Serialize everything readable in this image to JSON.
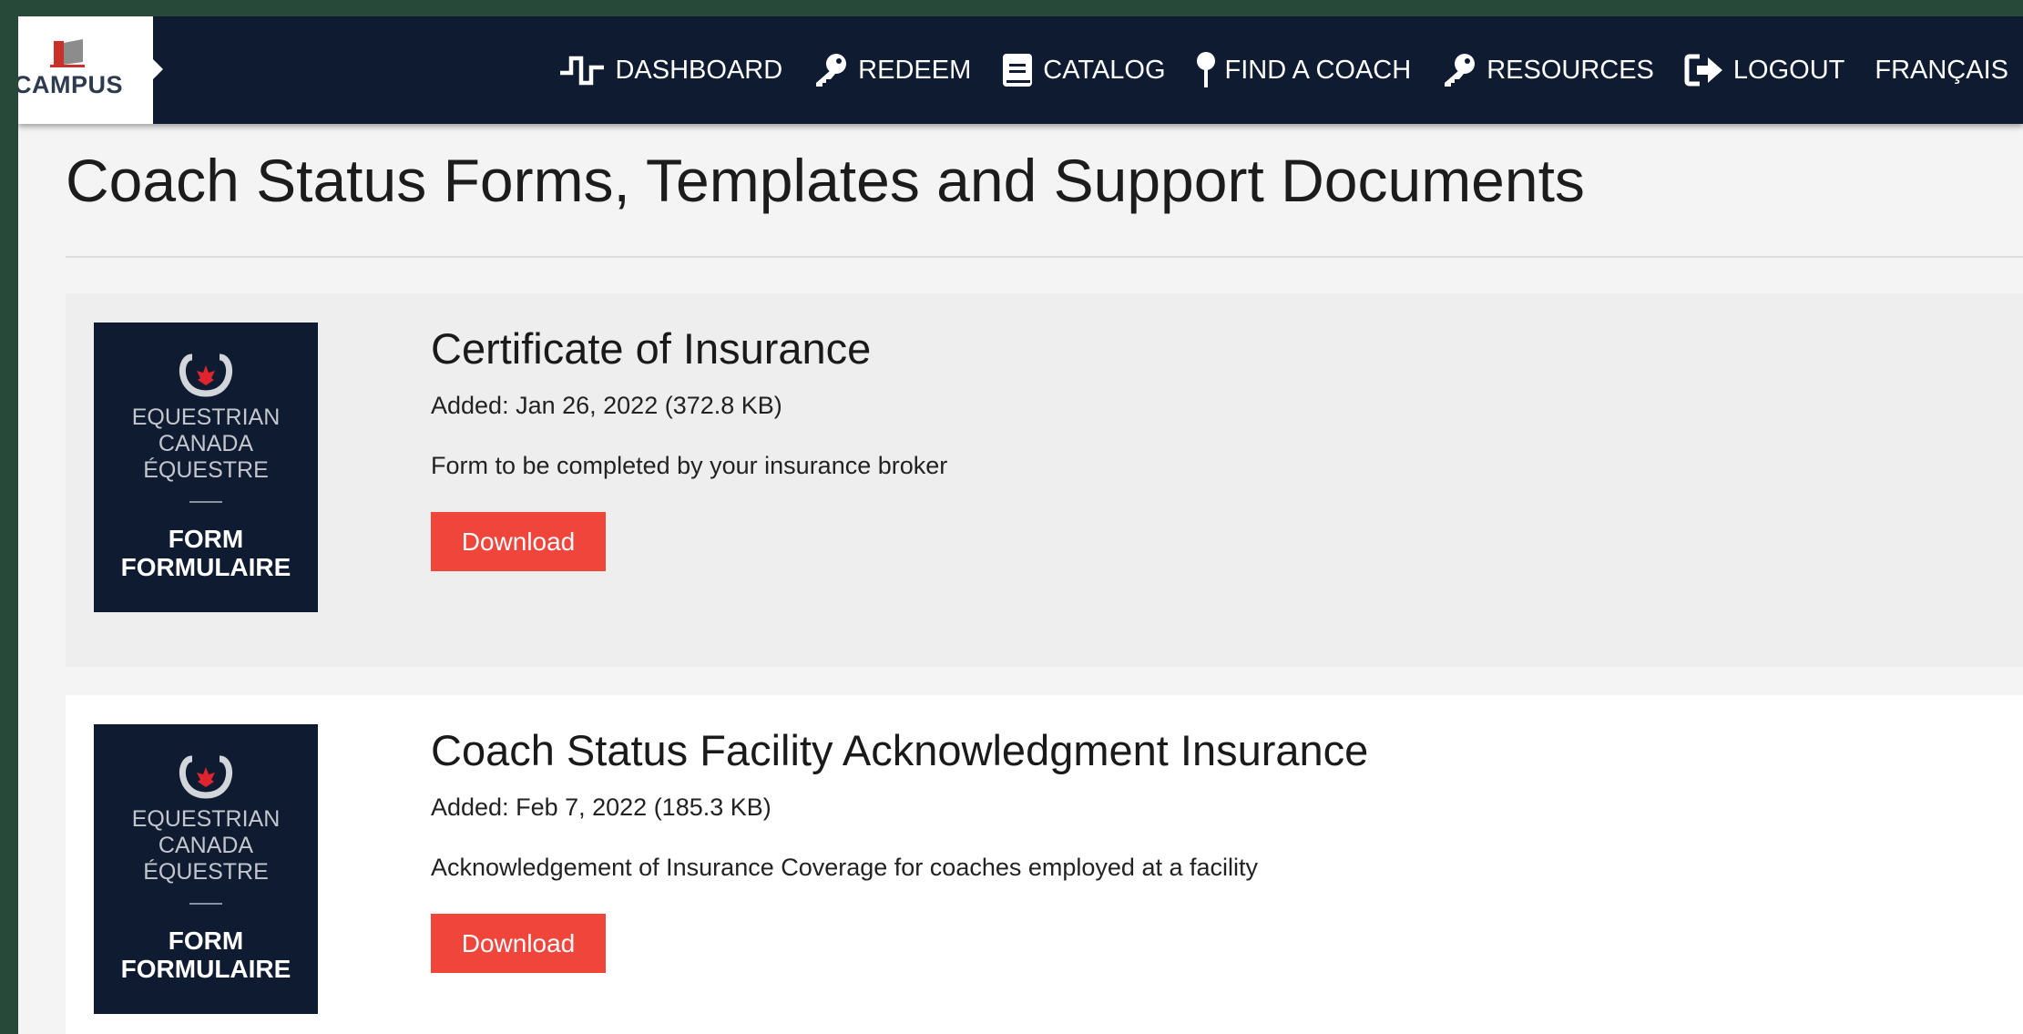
{
  "brand": {
    "logo_text": "CAMPUS"
  },
  "nav": {
    "items": [
      {
        "label": "DASHBOARD",
        "icon": "pulse-icon"
      },
      {
        "label": "REDEEM",
        "icon": "key-icon"
      },
      {
        "label": "CATALOG",
        "icon": "book-icon"
      },
      {
        "label": "FIND A COACH",
        "icon": "map-pin-icon"
      },
      {
        "label": "RESOURCES",
        "icon": "key-icon"
      },
      {
        "label": "LOGOUT",
        "icon": "logout-icon"
      },
      {
        "label": "FRANÇAIS",
        "icon": ""
      }
    ]
  },
  "page": {
    "title": "Coach Status Forms, Templates and Support Documents"
  },
  "thumbnail": {
    "line1": "EQUESTRIAN",
    "line2": "CANADA",
    "line3": "ÉQUESTRE",
    "line4": "FORM",
    "line5": "FORMULAIRE"
  },
  "documents": [
    {
      "title": "Certificate of Insurance",
      "meta": "Added: Jan 26, 2022 (372.8 KB)",
      "description": "Form to be completed by your insurance broker",
      "button": "Download"
    },
    {
      "title": "Coach Status Facility Acknowledgment Insurance",
      "meta": "Added: Feb 7, 2022 (185.3 KB)",
      "description": "Acknowledgement of Insurance Coverage for coaches employed at a facility",
      "button": "Download"
    }
  ],
  "colors": {
    "nav_bg": "#0e1b31",
    "accent": "#f0453a",
    "window_frame": "#27493a",
    "thumb_bg": "#0f1b30",
    "maple_red": "#e0242f"
  }
}
